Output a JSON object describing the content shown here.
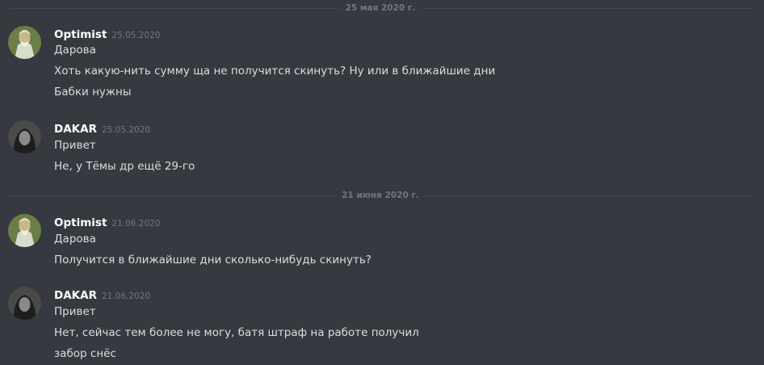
{
  "colors": {
    "background": "#36393f",
    "divider": "#42454a",
    "muted_text": "#72767d",
    "message_text": "#dcddde",
    "username": "#ffffff"
  },
  "dividers": [
    {
      "label": "25 мая 2020 г."
    },
    {
      "label": "21 июня 2020 г."
    }
  ],
  "messages": [
    {
      "author": "Optimist",
      "timestamp": "25.05.2020",
      "avatar_icon": "sage-avatar-icon",
      "lines": [
        "Дарова",
        "Хоть какую-нить сумму ща не получится скинуть? Ну или в ближайшие дни",
        "Бабки нужны"
      ]
    },
    {
      "author": "DAKAR",
      "timestamp": "25.05.2020",
      "avatar_icon": "dark-figure-avatar-icon",
      "lines": [
        "Привет",
        "Не, у Тёмы др ещё 29-го"
      ]
    },
    {
      "author": "Optimist",
      "timestamp": "21.06.2020",
      "avatar_icon": "sage-avatar-icon",
      "lines": [
        "Дарова",
        "Получится в ближайшие дни сколько-нибудь скинуть?"
      ]
    },
    {
      "author": "DAKAR",
      "timestamp": "21.06.2020",
      "avatar_icon": "dark-figure-avatar-icon",
      "lines": [
        "Привет",
        "Нет, сейчас тем более не могу, батя штраф на работе получил",
        "забор снёс"
      ]
    }
  ]
}
